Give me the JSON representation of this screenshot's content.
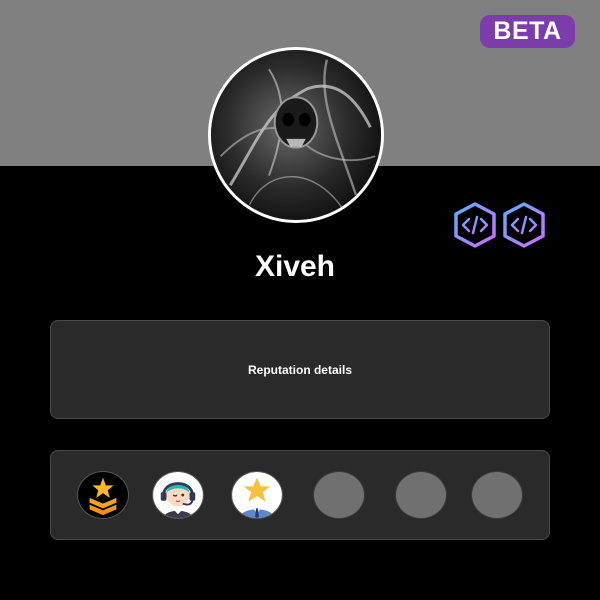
{
  "header": {
    "beta_label": "BETA",
    "banner_color": "#808080",
    "beta_color": "#7d3cab"
  },
  "profile": {
    "username": "Xiveh",
    "avatar_icon": "avatar-image",
    "dev_badges": [
      {
        "icon": "code-hexagon-icon"
      },
      {
        "icon": "code-hexagon-icon"
      }
    ]
  },
  "reputation": {
    "label": "Reputation details"
  },
  "achievements": [
    {
      "icon": "star-rank-chevrons-icon",
      "state": "earned"
    },
    {
      "icon": "support-agent-headset-icon",
      "state": "earned"
    },
    {
      "icon": "star-businessman-icon",
      "state": "earned"
    },
    {
      "icon": "locked-badge",
      "state": "locked"
    },
    {
      "icon": "locked-badge",
      "state": "locked"
    },
    {
      "icon": "locked-badge",
      "state": "locked"
    }
  ]
}
